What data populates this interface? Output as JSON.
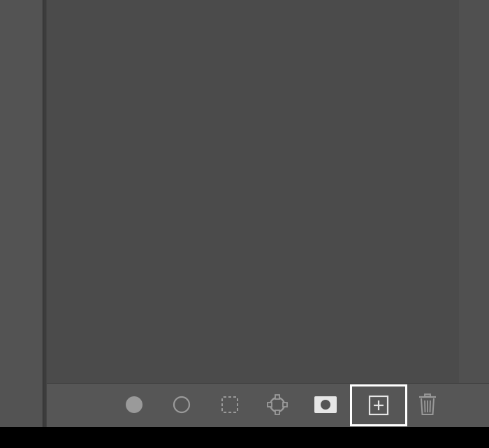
{
  "colors": {
    "panel_bg": "#535353",
    "canvas_bg": "#4b4b4b",
    "toolbar_bg": "#565656",
    "icon_gray": "#9a9a9a",
    "icon_light": "#e6e6e6",
    "highlight_border": "#ffffff"
  },
  "toolbar": {
    "tools": [
      {
        "icon": "filled-circle-icon"
      },
      {
        "icon": "hollow-circle-icon"
      },
      {
        "icon": "dashed-selection-icon"
      },
      {
        "icon": "path-anchor-icon"
      },
      {
        "icon": "layer-mask-icon"
      },
      {
        "icon": "new-item-icon",
        "highlighted": true
      },
      {
        "icon": "trash-icon"
      }
    ]
  }
}
